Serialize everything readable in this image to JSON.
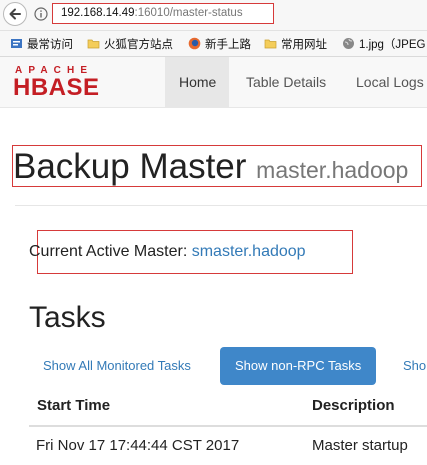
{
  "browser": {
    "url_host": "192.168.14.49",
    "url_rest": ":16010/master-status",
    "bookmarks": [
      {
        "label": "最常访问",
        "icon": "bookmark-icon"
      },
      {
        "label": "火狐官方站点",
        "icon": "folder-icon"
      },
      {
        "label": "新手上路",
        "icon": "firefox-icon"
      },
      {
        "label": "常用网址",
        "icon": "folder-icon"
      },
      {
        "label": "1.jpg（JPEG",
        "icon": "globe-icon"
      }
    ]
  },
  "navbar": {
    "logo_top": "APACHE",
    "logo_main": "HBASE",
    "links": [
      "Home",
      "Table Details",
      "Local Logs"
    ]
  },
  "page": {
    "title": "Backup Master",
    "host": "master.hadoop",
    "active_label": "Current Active Master: ",
    "active_host": "smaster.hadoop"
  },
  "tasks": {
    "heading": "Tasks",
    "tabs": [
      "Show All Monitored Tasks",
      "Show non-RPC Tasks",
      "Sho"
    ],
    "columns": [
      "Start Time",
      "Description"
    ],
    "rows": [
      [
        "Fri Nov 17 17:44:44 CST 2017",
        "Master startup"
      ]
    ]
  },
  "colors": {
    "brand": "#c41e24",
    "link": "#337ab7",
    "selected_tab": "#3f87c9",
    "highlight_box": "#d63a3a"
  }
}
